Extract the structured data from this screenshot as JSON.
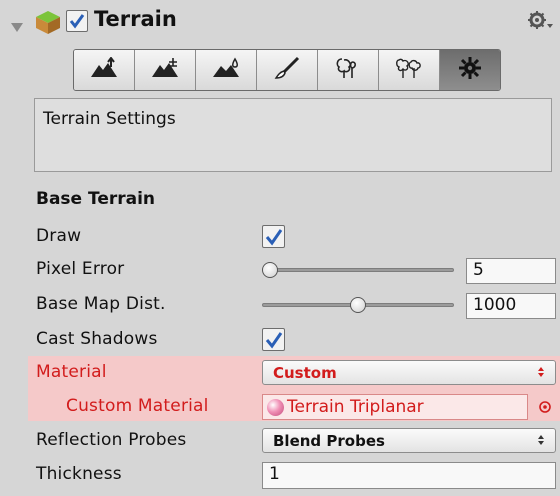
{
  "header": {
    "title": "Terrain",
    "enabled": true
  },
  "toolbar": {
    "tools": [
      {
        "icon": "raise-lower-terrain-icon",
        "active": false
      },
      {
        "icon": "paint-height-icon",
        "active": false
      },
      {
        "icon": "smooth-height-icon",
        "active": false
      },
      {
        "icon": "paint-texture-brush-icon",
        "active": false
      },
      {
        "icon": "place-trees-icon",
        "active": false
      },
      {
        "icon": "paint-details-icon",
        "active": false
      },
      {
        "icon": "terrain-settings-gear-icon",
        "active": true
      }
    ]
  },
  "help_box": {
    "text": "Terrain Settings"
  },
  "base_terrain": {
    "title": "Base Terrain",
    "draw": {
      "label": "Draw",
      "checked": true
    },
    "pixel_error": {
      "label": "Pixel Error",
      "value": "5",
      "fraction": 0.0
    },
    "base_map_dist": {
      "label": "Base Map Dist.",
      "value": "1000",
      "fraction": 0.5
    },
    "cast_shadows": {
      "label": "Cast Shadows",
      "checked": true
    },
    "material": {
      "label": "Material",
      "value": "Custom"
    },
    "custom_material": {
      "label": "Custom Material",
      "value": "Terrain Triplanar"
    },
    "reflection_probes": {
      "label": "Reflection Probes",
      "value": "Blend Probes"
    },
    "thickness": {
      "label": "Thickness",
      "value": "1"
    }
  },
  "colors": {
    "highlight_bg": "#f5c9c9",
    "highlight_text": "#d21c1c",
    "active_tool": "#7a7a7a"
  }
}
